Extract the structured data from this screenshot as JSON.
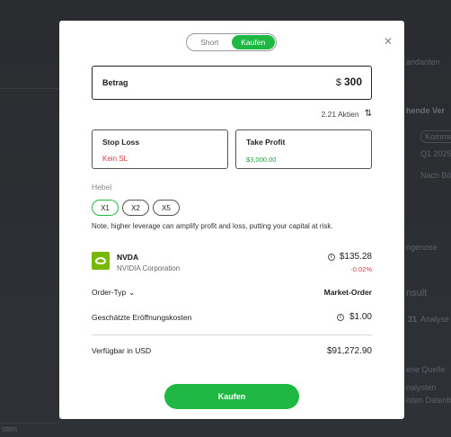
{
  "background": {
    "items": [
      "andanten",
      "hende Ver",
      "Kommen",
      "Q1 2025",
      "Nach Bö",
      "ngenose",
      "nsult",
      "31",
      "Analyse",
      "ene Quelle",
      "nalysten",
      "isten Datenb",
      "sten"
    ]
  },
  "modal": {
    "toggle": {
      "short_label": "Short",
      "buy_label": "Kaufen",
      "selected": "Kaufen"
    },
    "close_icon": "close-icon",
    "amount": {
      "label": "Betrag",
      "currency": "$",
      "value": "300"
    },
    "shares": {
      "text": "2.21 Aktien",
      "icon": "swap-icon"
    },
    "stop_loss": {
      "label": "Stop Loss",
      "value": "Kein SL"
    },
    "take_profit": {
      "label": "Take Profit",
      "value": "$3,000.00"
    },
    "leverage": {
      "label": "Hebel",
      "options": [
        "X1",
        "X2",
        "X5"
      ],
      "selected": "X1",
      "note": "Note, higher leverage can amplify profit and loss, putting your capital at risk."
    },
    "instrument": {
      "ticker": "NVDA",
      "company": "NVIDIA Corporation",
      "price": "$135.28",
      "change": "-0.02%",
      "logo": "nvidia-logo"
    },
    "order_type": {
      "label": "Order-Typ",
      "value": "Market-Order"
    },
    "estimated_cost": {
      "label": "Geschätzte Eröffnungskosten",
      "value": "$1.00"
    },
    "available": {
      "label": "Verfügbar in USD",
      "value": "$91,272.90"
    },
    "buy_button": "Kaufen"
  },
  "colors": {
    "accent": "#1fb842",
    "negative": "#e0373f",
    "positive": "#1a9f3a"
  }
}
